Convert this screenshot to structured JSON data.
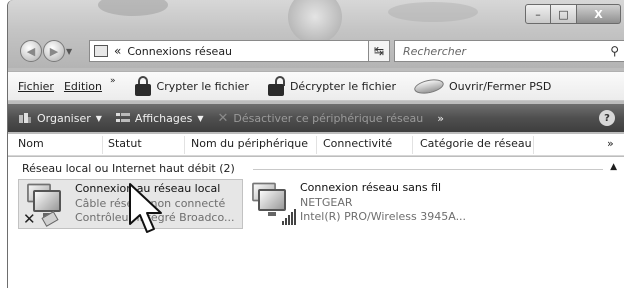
{
  "address": {
    "crumb_sep": "«",
    "crumb": "Connexions réseau"
  },
  "search": {
    "placeholder": "Rechercher"
  },
  "menubar": {
    "fichier": "Fichier",
    "edition": "Edition",
    "more": "»",
    "crypt": "Crypter le fichier",
    "decrypt": "Décrypter le fichier",
    "psd": "Ouvrir/Fermer PSD"
  },
  "cmdbar": {
    "organiser": "Organiser",
    "affichages": "Affichages",
    "desactiver": "Désactiver ce périphérique réseau",
    "more": "»",
    "help": "?"
  },
  "columns": {
    "nom": "Nom",
    "statut": "Statut",
    "peripherique": "Nom du périphérique",
    "connectivite": "Connectivité",
    "categorie": "Catégorie de réseau",
    "more": "»"
  },
  "group": {
    "label": "Réseau local ou Internet haut débit (2)"
  },
  "connections": [
    {
      "name": "Connexion au réseau local",
      "status": "Câble réseau non connecté",
      "device": "Contrôleur intégré Broadco..."
    },
    {
      "name": "Connexion réseau sans fil",
      "status": "NETGEAR",
      "device": "Intel(R) PRO/Wireless 3945A..."
    }
  ],
  "window_controls": {
    "minimize": "–",
    "maximize": "□",
    "close": "X"
  },
  "colors": {
    "glass": "#c4c4c4",
    "cmdbar": "#4f4f4f",
    "selection": "#e6e6e6"
  }
}
